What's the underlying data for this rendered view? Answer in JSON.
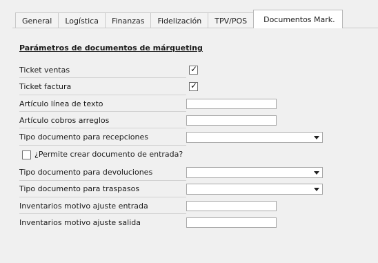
{
  "tabs": [
    {
      "label": "General"
    },
    {
      "label": "Logística"
    },
    {
      "label": "Finanzas"
    },
    {
      "label": "Fidelización"
    },
    {
      "label": "TPV/POS"
    },
    {
      "label": "Documentos Mark."
    }
  ],
  "section": {
    "title": "Parámetros de documentos de márqueting"
  },
  "fields": {
    "ticket_ventas": {
      "label": "Ticket ventas",
      "checked": true,
      "check_glyph": "✓"
    },
    "ticket_factura": {
      "label": "Ticket factura",
      "checked": true,
      "check_glyph": "✓"
    },
    "articulo_linea_texto": {
      "label": "Artículo línea de texto",
      "value": ""
    },
    "articulo_cobros_arreglos": {
      "label": "Artículo cobros arreglos",
      "value": ""
    },
    "tipo_doc_recepciones": {
      "label": "Tipo documento para recepciones",
      "value": ""
    },
    "permite_crear_doc_entrada": {
      "label": "¿Permite crear documento de entrada?",
      "checked": false
    },
    "tipo_doc_devoluciones": {
      "label": "Tipo documento para devoluciones",
      "value": ""
    },
    "tipo_doc_traspasos": {
      "label": "Tipo documento para traspasos",
      "value": ""
    },
    "inv_motivo_ajuste_entrada": {
      "label": "Inventarios motivo ajuste entrada",
      "value": ""
    },
    "inv_motivo_ajuste_salida": {
      "label": "Inventarios motivo ajuste salida",
      "value": ""
    }
  }
}
